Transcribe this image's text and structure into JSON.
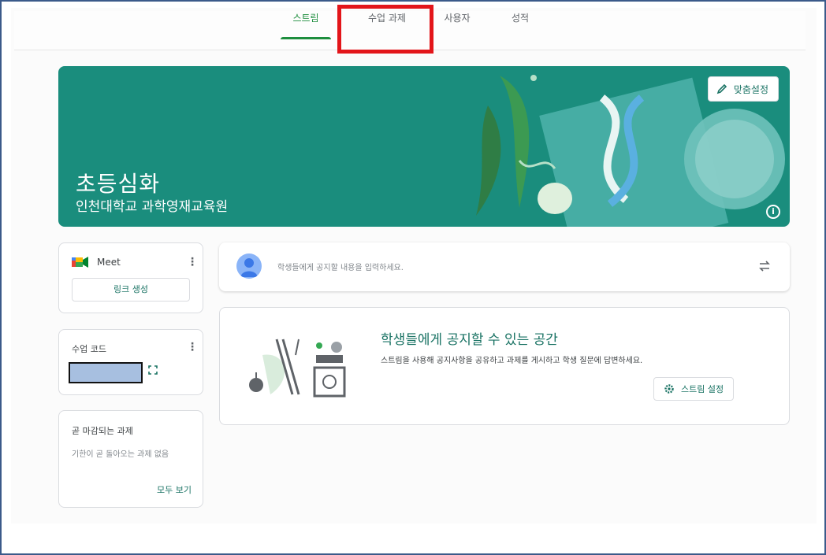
{
  "tabs": [
    {
      "label": "스트림",
      "active": true
    },
    {
      "label": "수업 과제",
      "active": false
    },
    {
      "label": "사용자",
      "active": false
    },
    {
      "label": "성적",
      "active": false
    }
  ],
  "banner": {
    "title": "초등심화",
    "subtitle": "인천대학교 과학영재교육원",
    "customize_label": "맞춤설정",
    "info_glyph": "i",
    "color": "#1a8d7d"
  },
  "meet": {
    "label": "Meet",
    "link_button": "링크 생성"
  },
  "class_code": {
    "label": "수업 코드"
  },
  "due": {
    "title": "곧 마감되는 과제",
    "empty_text": "기한이 곧 돌아오는 과제 없음",
    "view_all": "모두 보기"
  },
  "post": {
    "placeholder": "학생들에게 공지할 내용을 입력하세요."
  },
  "empty_state": {
    "title": "학생들에게 공지할 수 있는 공간",
    "description": "스트림을 사용해 공지사항을 공유하고 과제를 게시하고 학생 질문에 답변하세요.",
    "settings_button": "스트림 설정"
  },
  "colors": {
    "accent": "#1e8e3e",
    "brand_text": "#1a7364",
    "highlight": "#e3151a"
  },
  "icons": {
    "edit": "pencil-icon",
    "info": "info-icon",
    "meet": "meet-logo-icon",
    "more": "kebab-icon",
    "fullscreen": "fullscreen-icon",
    "repost": "repost-icon",
    "settings": "gear-icon"
  }
}
